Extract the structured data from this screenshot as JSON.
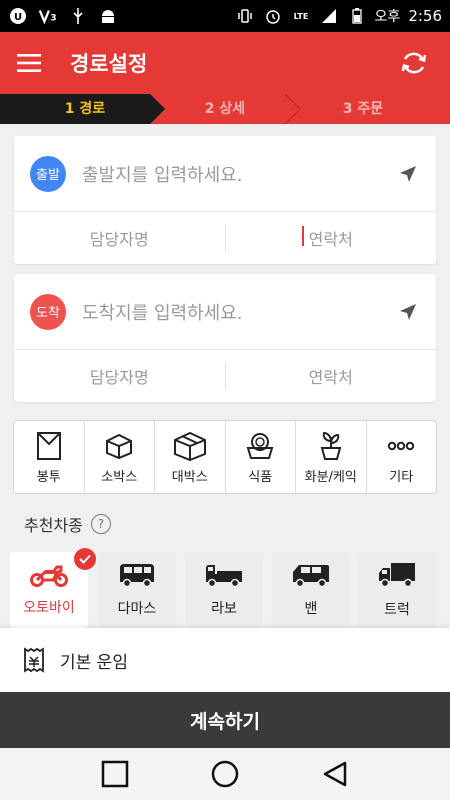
{
  "status_bar": {
    "time": "2:56",
    "ampm": "오후",
    "icons": [
      "u-plus-icon",
      "v3-icon",
      "usb-icon",
      "android-icon",
      "vibrate-icon",
      "alarm-icon",
      "lte-icon",
      "signal-icon",
      "battery-icon"
    ]
  },
  "header": {
    "title": "경로설정",
    "menu_icon": "hamburger-icon",
    "refresh_icon": "refresh-icon"
  },
  "steps": [
    {
      "label": "1 경로",
      "active": true
    },
    {
      "label": "2 상세",
      "active": false
    },
    {
      "label": "3 주문",
      "active": false
    }
  ],
  "origin": {
    "badge": "출발",
    "badge_color": "#4285f4",
    "placeholder": "출발지를 입력하세요.",
    "contact_name": "담당자명",
    "contact_phone": "연락처"
  },
  "destination": {
    "badge": "도착",
    "badge_color": "#ef5350",
    "placeholder": "도착지를 입력하세요.",
    "contact_name": "담당자명",
    "contact_phone": "연락처"
  },
  "categories": [
    {
      "label": "봉투",
      "icon": "envelope-icon"
    },
    {
      "label": "소박스",
      "icon": "small-box-icon"
    },
    {
      "label": "대박스",
      "icon": "large-box-icon"
    },
    {
      "label": "식품",
      "icon": "food-bowl-icon"
    },
    {
      "label": "화분/케익",
      "icon": "plant-pot-icon"
    },
    {
      "label": "기타",
      "icon": "more-dots-icon"
    }
  ],
  "recommended": {
    "title": "추천차종",
    "vehicles": [
      {
        "label": "오토바이",
        "icon": "motorcycle-icon",
        "selected": true
      },
      {
        "label": "다마스",
        "icon": "van-small-icon",
        "selected": false
      },
      {
        "label": "라보",
        "icon": "pickup-truck-icon",
        "selected": false
      },
      {
        "label": "밴",
        "icon": "van-icon",
        "selected": false
      },
      {
        "label": "트럭",
        "icon": "truck-icon",
        "selected": false
      }
    ]
  },
  "fare": {
    "label": "기본 운임",
    "icon": "receipt-icon"
  },
  "continue_button": "계속하기",
  "colors": {
    "primary": "#e53935",
    "active_step": "#f5c518",
    "dark_button": "#3a3a3a"
  }
}
